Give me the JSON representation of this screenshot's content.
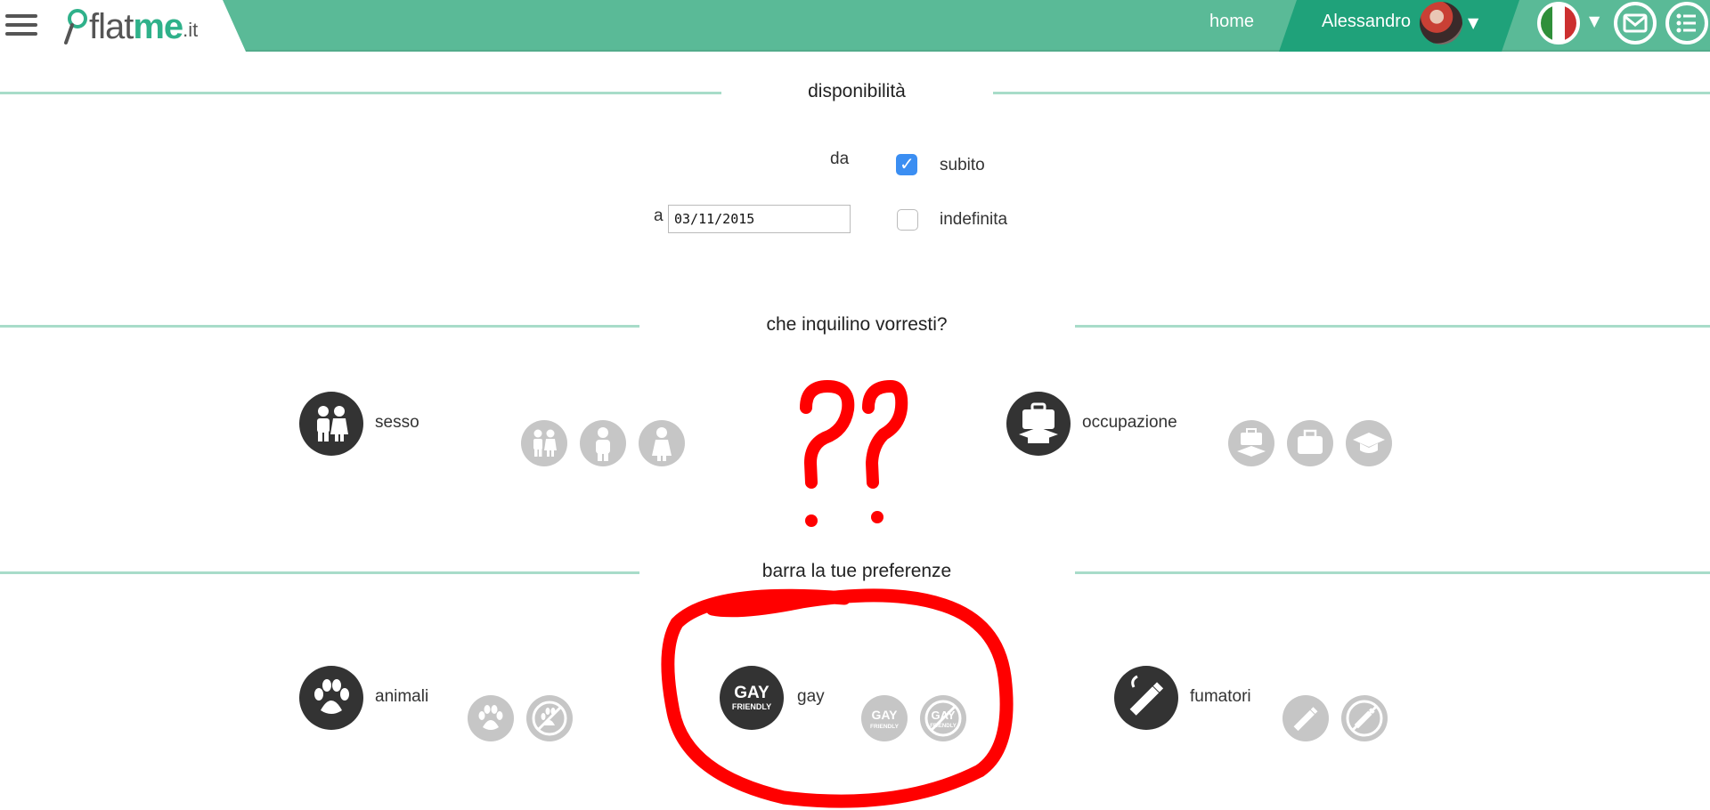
{
  "header": {
    "logo": {
      "flat": "flat",
      "me": "me",
      "it": ".it"
    },
    "nav_home": "home",
    "user_name": "Alessandro",
    "icons": [
      "menu-icon",
      "italy-flag-icon",
      "mail-icon",
      "list-icon"
    ],
    "brand_color": "#5aba97",
    "active_tab_color": "#1fa27a"
  },
  "availability": {
    "title": "disponibilità",
    "from_label": "da",
    "to_label": "a",
    "to_date": "03/11/2015",
    "immediately_label": "subito",
    "immediately_checked": true,
    "indefinite_label": "indefinita",
    "indefinite_checked": false
  },
  "tenant": {
    "title": "che inquilino vorresti?",
    "sex_label": "sesso",
    "sex_options": [
      "couple-icon",
      "male-icon",
      "female-icon"
    ],
    "occupation_label": "occupazione",
    "occupation_options": [
      "worker-student-icon",
      "worker-icon",
      "student-icon"
    ]
  },
  "preferences": {
    "title": "barra la tue preferenze",
    "animals_label": "animali",
    "animals_options": [
      "paw-icon",
      "no-paw-icon"
    ],
    "gay_label": "gay",
    "gay_badge_top": "GAY",
    "gay_badge_bottom": "FRIENDLY",
    "gay_options": [
      "gay-friendly-icon",
      "not-gay-friendly-icon"
    ],
    "smokers_label": "fumatori",
    "smokers_options": [
      "smoking-icon",
      "no-smoking-icon"
    ]
  },
  "annotation_color": "#ff0000"
}
